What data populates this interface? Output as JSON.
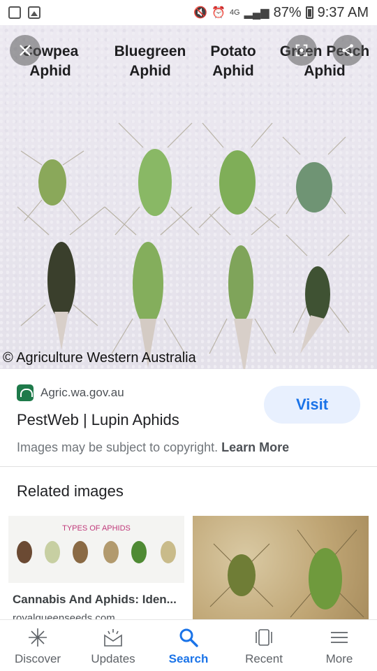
{
  "status_bar": {
    "battery": "87%",
    "time": "9:37 AM",
    "signal_glyph": "4G"
  },
  "image": {
    "species": [
      {
        "line1": "Cowpea",
        "line2": "Aphid"
      },
      {
        "line1": "Bluegreen",
        "line2": "Aphid"
      },
      {
        "line1": "Potato",
        "line2": "Aphid"
      },
      {
        "line1": "Green Peach",
        "line2": "Aphid"
      }
    ],
    "credit": "© Agriculture Western Australia",
    "icons": {
      "close": "close-icon",
      "lens": "lens-icon",
      "share": "share-icon"
    }
  },
  "result": {
    "source": "Agric.wa.gov.au",
    "title": "PestWeb | Lupin Aphids",
    "copyright_text": "Images may be subject to copyright.",
    "learn_more": "Learn More",
    "visit_label": "Visit"
  },
  "related": {
    "heading": "Related images",
    "cards": [
      {
        "thumb_title": "TYPES OF APHIDS",
        "title": "Cannabis And Aphids: Iden...",
        "source": "royalqueenseeds.com"
      },
      {
        "title": "",
        "source": ""
      }
    ]
  },
  "nav": {
    "items": [
      {
        "label": "Discover",
        "icon": "asterisk-icon"
      },
      {
        "label": "Updates",
        "icon": "updates-icon"
      },
      {
        "label": "Search",
        "icon": "search-icon"
      },
      {
        "label": "Recent",
        "icon": "recent-icon"
      },
      {
        "label": "More",
        "icon": "menu-icon"
      }
    ],
    "active": "Search"
  },
  "colors": {
    "accent": "#1a73e8",
    "visit_bg": "#e8f0fe",
    "favicon": "#1e7a4a"
  }
}
